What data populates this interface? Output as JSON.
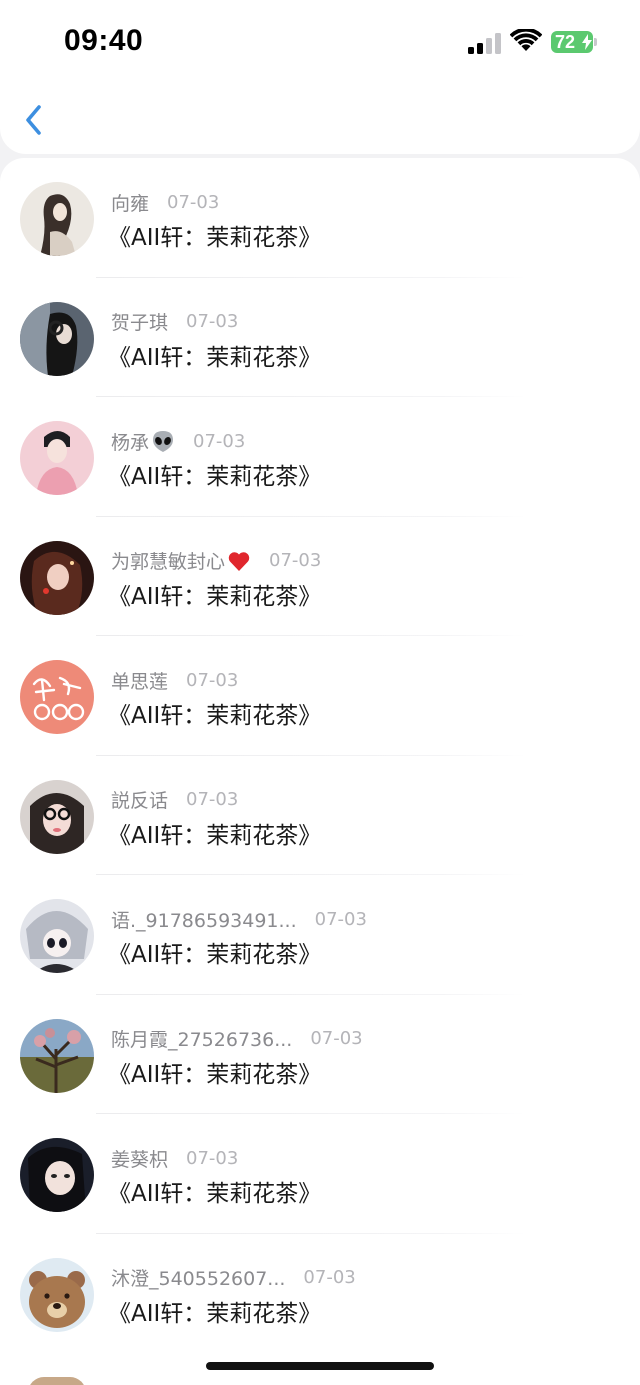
{
  "status_bar": {
    "time": "09:40",
    "battery": "72"
  },
  "header": {
    "back_icon": "chevron-left-icon"
  },
  "list": [
    {
      "name": "向雍",
      "date": "07-03",
      "message": "《AII轩：茉莉花茶》",
      "avatar": "ink-painting-girl"
    },
    {
      "name": "贺子琪",
      "date": "07-03",
      "message": "《AII轩：茉莉花茶》",
      "avatar": "girl-with-headphones"
    },
    {
      "name": "杨承",
      "emoji": "alien-emoji",
      "date": "07-03",
      "message": "《AII轩：茉莉花茶》",
      "avatar": "boy-pink-jacket"
    },
    {
      "name": "为郭慧敏封心",
      "emoji": "red-heart-emoji",
      "date": "07-03",
      "message": "《AII轩：茉莉花茶》",
      "avatar": "girl-red-light"
    },
    {
      "name": "单思莲",
      "date": "07-03",
      "message": "《AII轩：茉莉花茶》",
      "avatar": "coral-calligraphy"
    },
    {
      "name": "説反话",
      "date": "07-03",
      "message": "《AII轩：茉莉花茶》",
      "avatar": "girl-glasses"
    },
    {
      "name": "语._91786593491...",
      "date": "07-03",
      "message": "《AII轩：茉莉花茶》",
      "avatar": "anime-gray-hair"
    },
    {
      "name": "陈月霞_27526736...",
      "date": "07-03",
      "message": "《AII轩：茉莉花茶》",
      "avatar": "blossom-tree"
    },
    {
      "name": "姜葵枳",
      "date": "07-03",
      "message": "《AII轩：茉莉花茶》",
      "avatar": "girl-dark-hair"
    },
    {
      "name": "沐澄_540552607...",
      "date": "07-03",
      "message": "《AII轩：茉莉花茶》",
      "avatar": "brown-bear"
    }
  ],
  "colors": {
    "name": "#8a8a8e",
    "date": "#b4b4b8",
    "message": "#1a1a1a",
    "back": "#3d8fe0",
    "battery": "#5bc96f"
  }
}
